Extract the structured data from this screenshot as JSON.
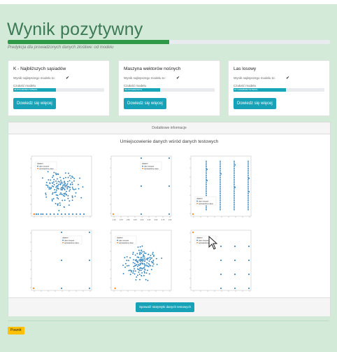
{
  "page": {
    "title": "Wynik pozytywny",
    "subtitle": "Predykcja dla prowadzonych danych złośliwe: od modelu",
    "progress_percent": 50,
    "accent_color": "#2e9a48",
    "button_color": "#17a2b8"
  },
  "models": [
    {
      "title": "K - Najbliższych sąsiadów",
      "best_label": "Wynik najlepszego modelu to:",
      "best_icon": "check-icon",
      "accuracy_label": "Czułość modelu",
      "accuracy_text": "45.8721820821718598%",
      "accuracy_percent": 46,
      "button": "Dowiedz się więcej"
    },
    {
      "title": "Maszyna wektorów nośnych",
      "best_label": "Wynik najlepszego modelu to:",
      "best_icon": "check-icon",
      "accuracy_label": "Czułość modelu",
      "accuracy_text": "39.26750282797%",
      "accuracy_percent": 39,
      "button": "Dowiedz się więcej"
    },
    {
      "title": "Las losowy",
      "best_label": "Wynik najlepszego modelu to:",
      "best_icon": "check-icon",
      "accuracy_label": "Czułość modelu",
      "accuracy_text": "57.1318289957437666%",
      "accuracy_percent": 57,
      "button": "Dowiedz się więcej"
    }
  ],
  "details": {
    "header": "Dodatkowe informacje",
    "plot_title": "Umiejscowienie danych wśród danych testowych",
    "stats_button": "Sprawdź statystyki danych testowych"
  },
  "legend": {
    "title": "dataset",
    "entries": [
      "dane testowe",
      "wprowadzone dane"
    ],
    "colors": [
      "#1f77b4",
      "#ff7f0e"
    ]
  },
  "chart_data": [
    {
      "type": "scatter",
      "style": "cloud",
      "xlim": [
        0,
        6000
      ],
      "ylim": [
        0,
        1000
      ],
      "xlabel": "",
      "series": [
        {
          "name": "dane testowe",
          "points": [
            [
              100,
              0
            ],
            [
              300,
              0
            ],
            [
              500,
              0
            ],
            [
              800,
              0
            ],
            [
              1000,
              0
            ],
            [
              1400,
              0
            ],
            [
              1800,
              0
            ],
            [
              2200,
              0
            ],
            [
              2600,
              0
            ],
            [
              3000,
              0
            ],
            [
              3400,
              0
            ],
            [
              3800,
              0
            ],
            [
              4200,
              0
            ],
            [
              4600,
              0
            ],
            [
              5000,
              0
            ],
            [
              5400,
              0
            ]
          ]
        },
        {
          "name": "wprowadzone dane",
          "points": [
            [
              50,
              0
            ]
          ]
        }
      ]
    },
    {
      "type": "scatter",
      "style": "sparse",
      "xlim": [
        -1,
        1
      ],
      "ylim": [
        -1,
        1
      ],
      "xlabel": "",
      "ticks_x": [
        "-1.00",
        "-0.75",
        "-0.50",
        "-0.25",
        "0.00",
        "0.25",
        "0.50",
        "0.75",
        "1.00"
      ],
      "series": [
        {
          "name": "dane testowe",
          "points": [
            [
              0,
              1
            ],
            [
              1,
              1
            ],
            [
              0,
              0
            ],
            [
              1,
              0
            ],
            [
              0,
              -1
            ],
            [
              1,
              -1
            ]
          ]
        },
        {
          "name": "wprowadzone dane",
          "points": [
            [
              -1,
              -1
            ]
          ]
        }
      ]
    },
    {
      "type": "scatter",
      "style": "stripes",
      "xlim": [
        0,
        4
      ],
      "ylim": [
        0,
        250
      ],
      "xlabel": "",
      "series": [
        {
          "name": "dane testowe",
          "points": [
            [
              1,
              200
            ],
            [
              1,
              150
            ],
            [
              2,
              180
            ],
            [
              3,
              220
            ],
            [
              3,
              120
            ],
            [
              4,
              160
            ],
            [
              4,
              100
            ]
          ]
        },
        {
          "name": "wprowadzone dane",
          "points": [
            [
              0,
              0
            ]
          ]
        }
      ]
    },
    {
      "type": "scatter",
      "style": "sparse",
      "xlim": [
        -1,
        1
      ],
      "ylim": [
        -1,
        1
      ],
      "xlabel": "",
      "series": [
        {
          "name": "dane testowe",
          "points": [
            [
              0,
              1
            ],
            [
              1,
              1
            ],
            [
              0,
              0
            ],
            [
              1,
              0
            ],
            [
              0,
              -1
            ],
            [
              1,
              -1
            ]
          ]
        },
        {
          "name": "wprowadzone dane",
          "points": [
            [
              -1,
              -1
            ]
          ]
        }
      ]
    },
    {
      "type": "scatter",
      "style": "cloud",
      "xlim": [
        0,
        300
      ],
      "ylim": [
        0,
        1
      ],
      "xlabel": "",
      "series": [
        {
          "name": "dane testowe",
          "points": [
            [
              150,
              0.5
            ]
          ]
        },
        {
          "name": "wprowadzone dane",
          "points": [
            [
              10,
              0
            ]
          ]
        }
      ]
    },
    {
      "type": "scatter",
      "style": "grid",
      "xlim": [
        -1,
        1
      ],
      "ylim": [
        -1,
        1
      ],
      "xlabel": "",
      "series": [
        {
          "name": "dane testowe",
          "points": [
            [
              0,
              0.5
            ],
            [
              0.5,
              0.5
            ],
            [
              1,
              0.5
            ],
            [
              0,
              0
            ],
            [
              0.5,
              0
            ],
            [
              1,
              0
            ],
            [
              0,
              -0.5
            ],
            [
              0.5,
              -0.5
            ],
            [
              1,
              -0.5
            ],
            [
              0,
              -1
            ],
            [
              0.5,
              -1
            ],
            [
              1,
              -1
            ]
          ]
        },
        {
          "name": "wprowadzone dane",
          "points": [
            [
              -1,
              1
            ]
          ]
        }
      ]
    }
  ],
  "back_button": "Powrót"
}
